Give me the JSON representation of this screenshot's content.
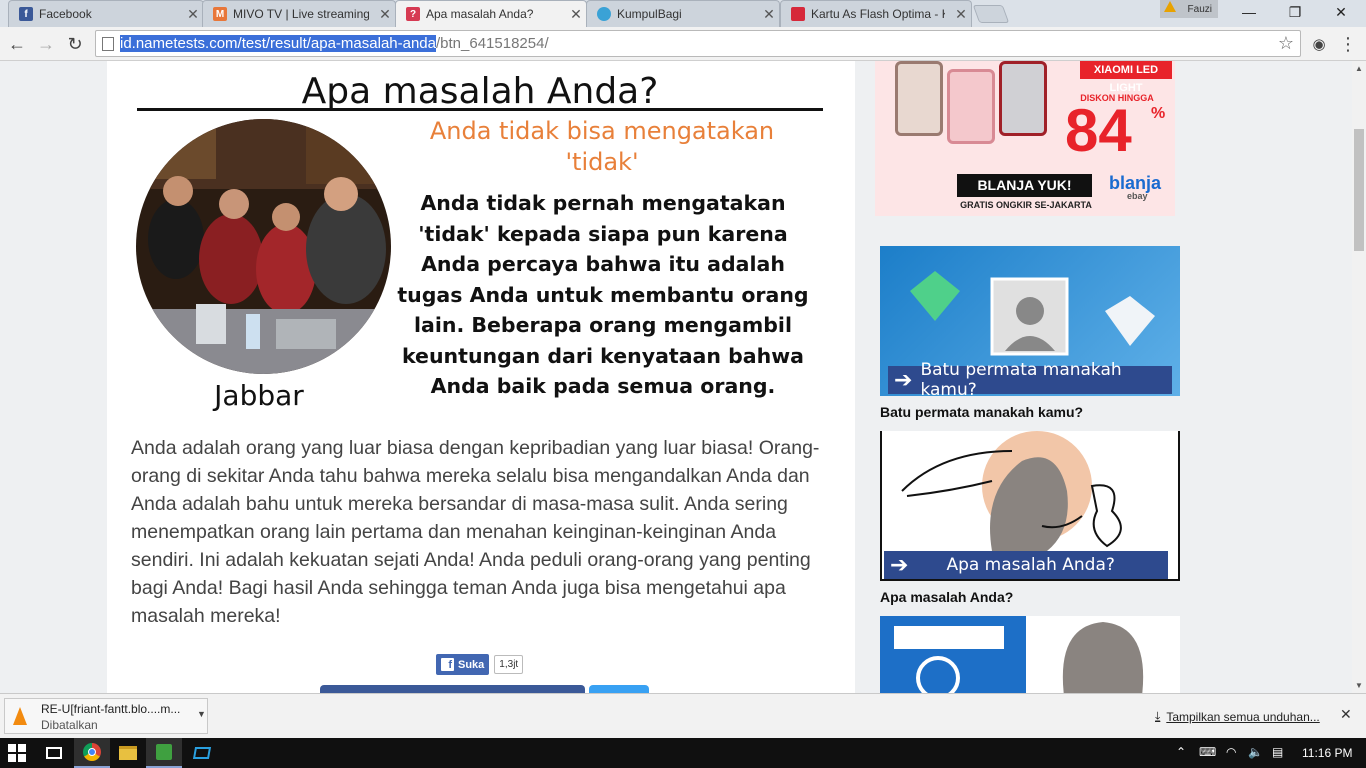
{
  "browser": {
    "tabs": [
      {
        "title": "Facebook",
        "icon": "facebook-icon",
        "color": "#3b5998",
        "glyph": "f"
      },
      {
        "title": "MIVO TV | Live streaming",
        "icon": "mivo-icon",
        "color": "#e8773a",
        "glyph": "M"
      },
      {
        "title": "Apa masalah Anda?",
        "icon": "nametests-icon",
        "color": "#d63a52",
        "glyph": "?"
      },
      {
        "title": "KumpulBagi",
        "icon": "kumpulbagi-icon",
        "color": "#3aa2d6",
        "glyph": ""
      },
      {
        "title": "Kartu As Flash Optima - K",
        "icon": "telkomsel-icon",
        "color": "#d6283a",
        "glyph": ""
      }
    ],
    "active_tab": 2,
    "user": "Fauzi",
    "url_selected": "id.nametests.com/test/result/apa-masalah-anda",
    "url_rest": "/btn_641518254/"
  },
  "result": {
    "title": "Apa masalah Anda?",
    "name": "Jabbar",
    "headline": "Anda tidak bisa mengatakan 'tidak'",
    "text": "Anda tidak pernah mengatakan 'tidak' kepada siapa pun karena Anda percaya bahwa itu adalah tugas Anda untuk membantu orang lain. Beberapa orang mengambil keuntungan dari kenyataan bahwa Anda baik pada semua orang.",
    "body": "Anda adalah orang yang luar biasa dengan kepribadian yang luar biasa! Orang-orang di sekitar Anda tahu bahwa mereka selalu bisa mengandalkan Anda dan Anda adalah bahu untuk mereka bersandar di masa-masa sulit. Anda sering menempatkan orang lain pertama dan menahan keinginan-keinginan Anda sendiri. Ini adalah kekuatan sejati Anda! Anda peduli orang-orang yang penting bagi Anda! Bagi hasil Anda sehingga teman Anda juga bisa mengetahui apa masalah mereka!"
  },
  "facebook_like": {
    "label": "Suka",
    "count": "1,3jt"
  },
  "ad": {
    "badge": "XIAOMI LED LIGHT",
    "discount_label": "DISKON HINGGA",
    "discount_value": "84",
    "percent": "%",
    "cta": "BLANJA YUK!",
    "brand": "blanja",
    "partner": "ebay",
    "shipping": "GRATIS ONGKIR SE-JAKARTA"
  },
  "sidebar": {
    "quiz1_banner": "Batu permata manakah kamu?",
    "quiz1_caption": "Batu permata manakah kamu?",
    "quiz2_banner": "Apa masalah Anda?",
    "quiz2_caption": "Apa masalah Anda?"
  },
  "downloads": {
    "filename": "RE-U[friant-fantt.blo....m...",
    "status": "Dibatalkan",
    "show_all": "Tampilkan semua unduhan..."
  },
  "taskbar": {
    "time": "11:16 PM"
  }
}
